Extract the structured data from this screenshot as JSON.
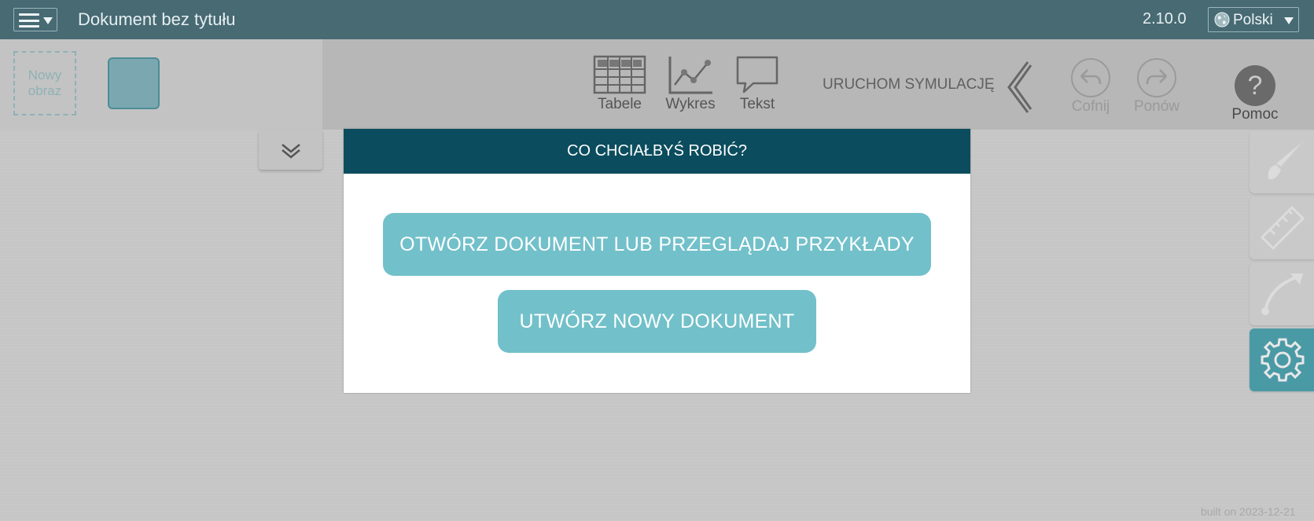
{
  "topbar": {
    "document_title": "Dokument bez tytułu",
    "version": "2.10.0",
    "language": "Polski"
  },
  "left_panel": {
    "new_image_label": "Nowy obraz"
  },
  "toolbar": {
    "tables_label": "Tabele",
    "chart_label": "Wykres",
    "text_label": "Tekst",
    "simulation_label": "URUCHOM SYMULACJĘ",
    "undo_label": "Cofnij",
    "redo_label": "Ponów",
    "help_label": "Pomoc",
    "help_glyph": "?"
  },
  "right_tools": [
    {
      "icon": "brush-icon"
    },
    {
      "icon": "ruler-icon"
    },
    {
      "icon": "curve-arrow-icon"
    },
    {
      "icon": "gear-icon",
      "active": true
    }
  ],
  "modal": {
    "title": "CO CHCIAŁBYŚ ROBIĆ?",
    "open_button": "OTWÓRZ DOKUMENT LUB PRZEGLĄDAJ PRZYKŁADY",
    "create_button": "UTWÓRZ NOWY DOKUMENT"
  },
  "footer": {
    "built": "built on 2023-12-21"
  },
  "colors": {
    "topbar": "#476a73",
    "modal_header": "#0b4d5e",
    "modal_button": "#72c0ca",
    "active_tool": "#4a9aa6"
  }
}
